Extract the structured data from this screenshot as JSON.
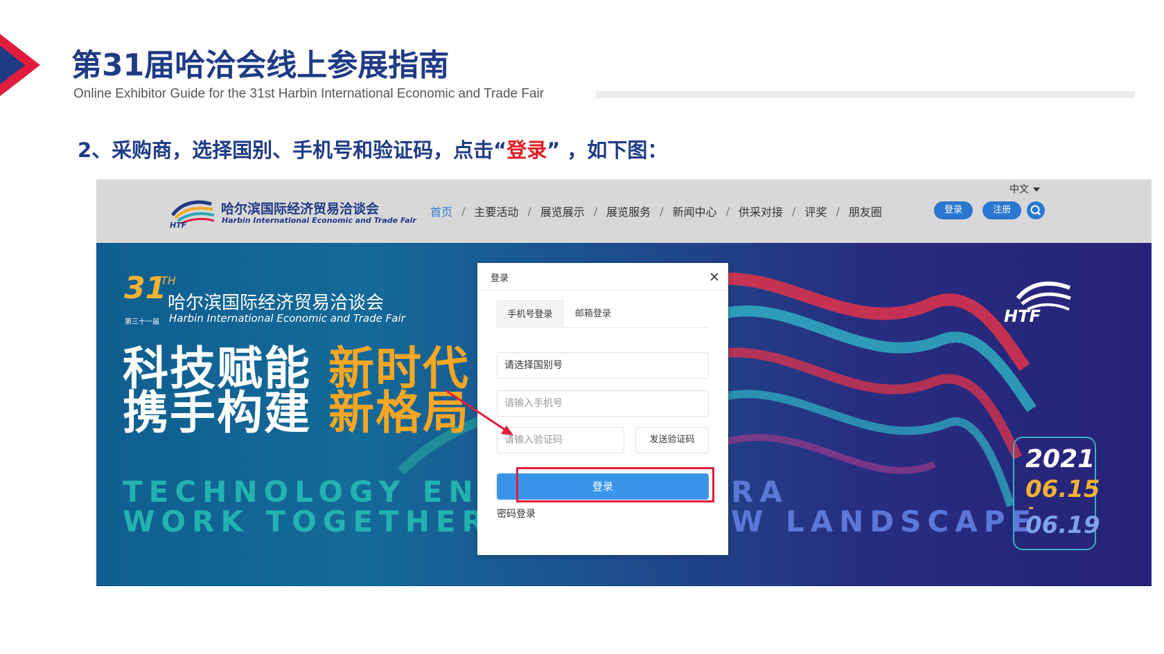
{
  "slide": {
    "title": "第31届哈洽会线上参展指南",
    "subtitle": "Online Exhibitor Guide for the 31st Harbin International Economic and Trade Fair",
    "step_prefix": "2、采购商，选择国别、手机号和验证码，点击“",
    "step_highlight": "登录",
    "step_suffix": "”  ，如下图：",
    "accent_color": "#1f3b86",
    "highlight_color": "#e21c24"
  },
  "site_header": {
    "logo_cn": "哈尔滨国际经济贸易洽谈会",
    "logo_en": "Harbin International Economic and Trade Fair",
    "logo_mark": "HTF",
    "language": "中文",
    "nav": [
      {
        "label": "首页",
        "active": true
      },
      {
        "label": "主要活动"
      },
      {
        "label": "展览展示"
      },
      {
        "label": "展览服务"
      },
      {
        "label": "新闻中心"
      },
      {
        "label": "供采对接"
      },
      {
        "label": "评奖"
      },
      {
        "label": "朋友圈"
      }
    ],
    "nav_separator": "/",
    "login_label": "登录",
    "register_label": "注册"
  },
  "banner": {
    "edition_num": "31",
    "edition_suffix": "TH",
    "fair_cn": "哈尔滨国际经济贸易洽谈会",
    "fair_ordinal": "第三十一届",
    "fair_en": "Harbin International Economic and Trade Fair",
    "slogan_1_white": "科技赋能",
    "slogan_1_yellow": "新时代",
    "slogan_2_white": "携手构建",
    "slogan_2_yellow": "新格局",
    "slogan_en_1": "TECHNOLOGY ENAB",
    "slogan_en_2": "WORK TOGETHER T",
    "slogan_en_right_1": "RA",
    "slogan_en_right_2": "W LANDSCAPE",
    "logo_text": "HTF",
    "date_year": "2021",
    "date_start": "06.15",
    "date_dash": "-",
    "date_end": "06.19"
  },
  "login_modal": {
    "title": "登录",
    "tabs": [
      "手机号登录",
      "邮箱登录"
    ],
    "country_placeholder": "请选择国别号",
    "phone_placeholder": "请输入手机号",
    "code_placeholder": "请输入验证码",
    "send_code_label": "发送验证码",
    "login_label": "登录",
    "password_login_label": "密码登录"
  }
}
